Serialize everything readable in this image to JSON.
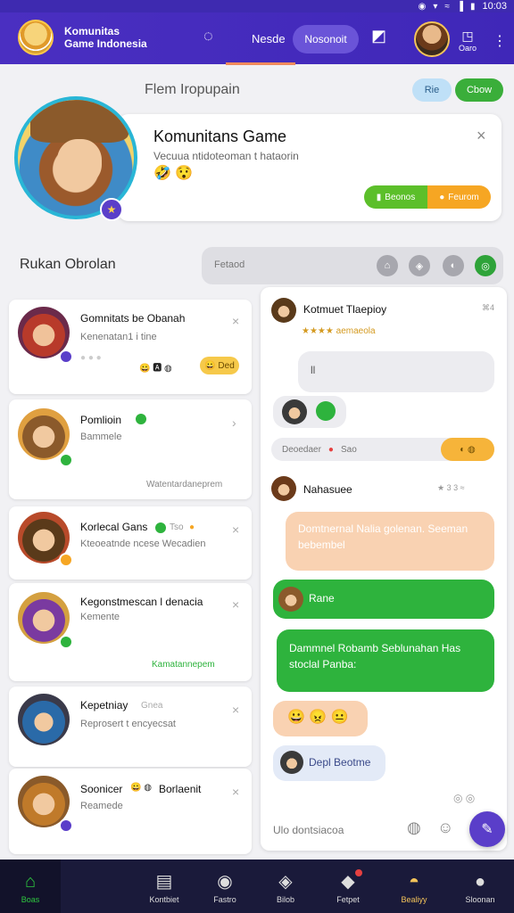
{
  "status_bar": {
    "time": "10:03",
    "icons": [
      "◉",
      "▾",
      "≈",
      "▐",
      "▮"
    ]
  },
  "header": {
    "title_line1": "Komunitas",
    "title_line2": "Game Indonesia",
    "nav_link": "Nesde",
    "nav_pill": "Nosonoit",
    "chat_icon": "◌",
    "bookmark_icon": "◩",
    "user_icon": "◳",
    "user_label": "Oaro",
    "menu_icon": "⋮"
  },
  "profile": {
    "section_title": "Flem Iropupain",
    "chip_blue": "Rie",
    "chip_green": "Cbow",
    "name": "Komunitans Game",
    "desc": "Vecuua ntidoteoman t hataorin",
    "emoji": "🤣 😯",
    "close": "×",
    "action_left": "Beonos",
    "action_left_icon": "▮",
    "action_right": "Feurom",
    "action_right_icon": "●",
    "badge": "★"
  },
  "chat_section": {
    "title": "Rukan Obrolan",
    "search_placeholder": "Fetaod",
    "btn1": "⌂",
    "btn2": "◈",
    "btn3": "◐",
    "btn4": "◎"
  },
  "list": [
    {
      "title": "Gomnitats be Obanah",
      "sub": "Kenenatan1 i tine",
      "extra": "● ● ●",
      "reacts": "😀 🅰 ◍",
      "pill": "😀 Ded"
    },
    {
      "title": "Pomlioin",
      "sub": "Bammele",
      "footer": "Watentardaneprem"
    },
    {
      "title": "Korlecal Gans",
      "sub": "Kteoeatnde ncese Wecadien",
      "tag": "Tso",
      "dot": "●"
    },
    {
      "title": "Kegonstmescan l denacia",
      "sub": "Kemente",
      "footer": "Kamatannepem"
    },
    {
      "title": "Kepetniay",
      "sub": "Reprosert t encyecsat",
      "tag": "Gnea"
    },
    {
      "title": "Soonicer",
      "sub": "Reamede",
      "tail": "Borlaenit",
      "emojis": "😀 ◍"
    }
  ],
  "chat": {
    "header_name": "Kotmuet Tlaepioy",
    "header_meta": "⌘4",
    "header_sub": "★★★★ aemaeola",
    "bubble1": "ll",
    "reaction_pill": "Deoedaer",
    "reaction_pill_2": "Sao",
    "reaction_right": "◐ ◍",
    "msg2_name": "Nahasuee",
    "msg2_meta": "★ 3 3 ≈",
    "bubble_peach": "Domtnernal Nalia golenan. Seeman bebembel",
    "bubble_green_short": "Rane",
    "bubble_green_long": "Dammnel Robamb Seblunahan Has stoclal Panba:",
    "emoji_row": "😀 😠 😐",
    "bubble_lilac": "Depl Beotme",
    "footer_meta": "◎ ◎",
    "input_placeholder": "Ulo dontsiacoa",
    "input_icon1": "◍",
    "input_icon2": "☺",
    "fab": "✎"
  },
  "bottom_nav": [
    {
      "label": "Boas",
      "icon": "⌂"
    },
    {
      "label": "Kontbiet",
      "icon": "▤"
    },
    {
      "label": "Fastro",
      "icon": "◉"
    },
    {
      "label": "Bilob",
      "icon": "◈"
    },
    {
      "label": "Fetpet",
      "icon": "◆"
    },
    {
      "label": "Bealiyy",
      "icon": "◓"
    },
    {
      "label": "Sloonan",
      "icon": "●"
    }
  ],
  "colors": {
    "brand": "#4a2fc1",
    "green": "#2eb33d",
    "peach": "#f9d2b2",
    "orange": "#f6a623"
  }
}
